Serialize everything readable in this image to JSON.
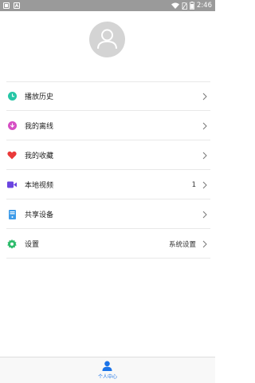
{
  "status_bar": {
    "time": "2:46",
    "icons": [
      "sim-icon",
      "notification-a-icon",
      "wifi-icon",
      "no-sim-icon",
      "battery-icon"
    ]
  },
  "profile": {
    "avatar_icon": "person-icon"
  },
  "menu": {
    "items": [
      {
        "label": "播放历史",
        "icon": "clock-icon",
        "color": "#26c6a6",
        "value": ""
      },
      {
        "label": "我的离线",
        "icon": "download-icon",
        "color": "#d64fc4",
        "value": ""
      },
      {
        "label": "我的收藏",
        "icon": "heart-icon",
        "color": "#ea3a3a",
        "value": ""
      },
      {
        "label": "本地视频",
        "icon": "video-camera-icon",
        "color": "#6a44e0",
        "value": "1"
      },
      {
        "label": "共享设备",
        "icon": "device-icon",
        "color": "#3d9be9",
        "value": ""
      },
      {
        "label": "设置",
        "icon": "gear-icon",
        "color": "#2dbb6b",
        "value": "系统设置"
      }
    ]
  },
  "bottom_nav": {
    "label": "个人中心",
    "icon": "person-icon",
    "color": "#1a73e8"
  }
}
